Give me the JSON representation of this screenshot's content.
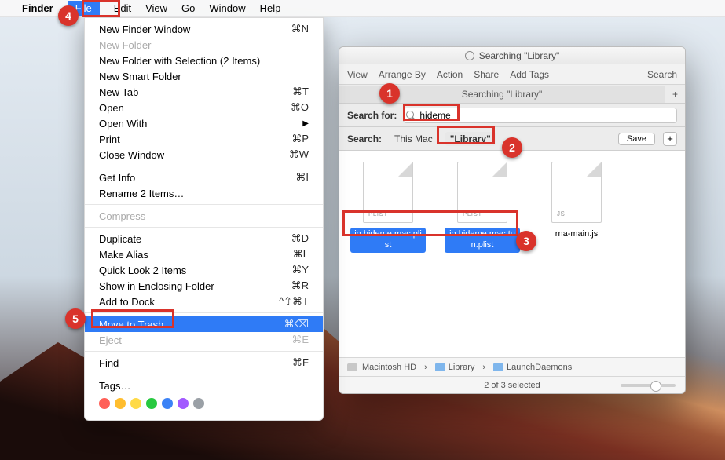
{
  "menubar": {
    "app": "Finder",
    "items": [
      "File",
      "Edit",
      "View",
      "Go",
      "Window",
      "Help"
    ]
  },
  "dropdown": {
    "groups": [
      [
        {
          "label": "New Finder Window",
          "sc": "⌘N"
        },
        {
          "label": "New Folder",
          "sc": "",
          "disabled": true
        },
        {
          "label": "New Folder with Selection (2 Items)",
          "sc": ""
        },
        {
          "label": "New Smart Folder",
          "sc": ""
        },
        {
          "label": "New Tab",
          "sc": "⌘T"
        },
        {
          "label": "Open",
          "sc": "⌘O"
        },
        {
          "label": "Open With",
          "sc": "",
          "submenu": true
        },
        {
          "label": "Print",
          "sc": "⌘P"
        },
        {
          "label": "Close Window",
          "sc": "⌘W"
        }
      ],
      [
        {
          "label": "Get Info",
          "sc": "⌘I"
        },
        {
          "label": "Rename 2 Items…",
          "sc": ""
        }
      ],
      [
        {
          "label": "Compress",
          "sc": "",
          "disabled": true
        }
      ],
      [
        {
          "label": "Duplicate",
          "sc": "⌘D"
        },
        {
          "label": "Make Alias",
          "sc": "⌘L"
        },
        {
          "label": "Quick Look 2 Items",
          "sc": "⌘Y"
        },
        {
          "label": "Show in Enclosing Folder",
          "sc": "⌘R"
        },
        {
          "label": "Add to Dock",
          "sc": "^⇧⌘T"
        }
      ],
      [
        {
          "label": "Move to Trash",
          "sc": "⌘⌫",
          "hovered": true
        },
        {
          "label": "Eject",
          "sc": "⌘E",
          "disabled": true
        }
      ],
      [
        {
          "label": "Find",
          "sc": "⌘F"
        }
      ],
      [
        {
          "label": "Tags…",
          "sc": ""
        }
      ]
    ],
    "tag_colors": [
      "#ff5f57",
      "#ffbd2e",
      "#ffda47",
      "#28c940",
      "#3b82f6",
      "#a259ff",
      "#9aa0a6"
    ]
  },
  "finder": {
    "title": "Searching \"Library\"",
    "toolbar": {
      "items": [
        "View",
        "Arrange By",
        "Action",
        "Share",
        "Add Tags"
      ],
      "search": "Search"
    },
    "tab": "Searching \"Library\"",
    "searchfor_label": "Search for:",
    "search_value": "hideme",
    "scope": {
      "label": "Search:",
      "this_mac": "This Mac",
      "library": "\"Library\"",
      "save": "Save"
    },
    "files": [
      {
        "name": "io.hideme.mac.plist",
        "badge": "PLIST",
        "selected": true
      },
      {
        "name": "io.hideme.mac.tun.plist",
        "badge": "PLIST",
        "selected": true
      },
      {
        "name": "rna-main.js",
        "badge": "JS",
        "selected": false
      }
    ],
    "path": [
      "Macintosh HD",
      "Library",
      "LaunchDaemons"
    ],
    "status": "2 of 3 selected"
  },
  "callouts": {
    "1": "1",
    "2": "2",
    "3": "3",
    "4": "4",
    "5": "5"
  }
}
